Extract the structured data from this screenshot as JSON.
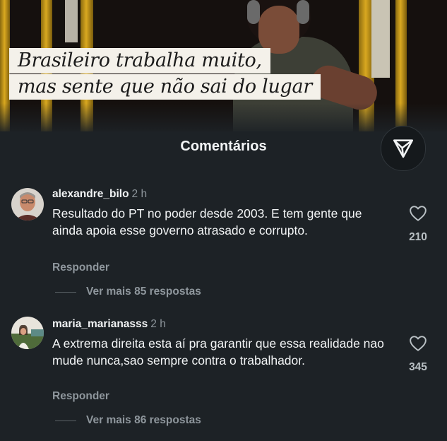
{
  "post": {
    "headline_line1": "Brasileiro trabalha muito,",
    "headline_line2": "mas sente que não sai do lugar"
  },
  "comments_sheet": {
    "title": "Comentários",
    "send_icon": "send-icon"
  },
  "comments": [
    {
      "username": "alexandre_bilo",
      "time": "2 h",
      "text": "Resultado do PT no poder desde 2003. E tem gente que ainda apoia esse governo atrasado e corrupto.",
      "likes": "210",
      "reply_label": "Responder",
      "more_replies": "Ver mais 85 respostas"
    },
    {
      "username": "maria_marianasss",
      "time": "2 h",
      "text": "A extrema direita esta aí  pra garantir  que essa realidade nao mude nunca,sao sempre contra o trabalhador.",
      "likes": "345",
      "reply_label": "Responder",
      "more_replies": "Ver mais 86 respostas"
    }
  ],
  "colors": {
    "background": "#1d2226",
    "text": "#f2f4f5",
    "muted": "#8e969c"
  }
}
